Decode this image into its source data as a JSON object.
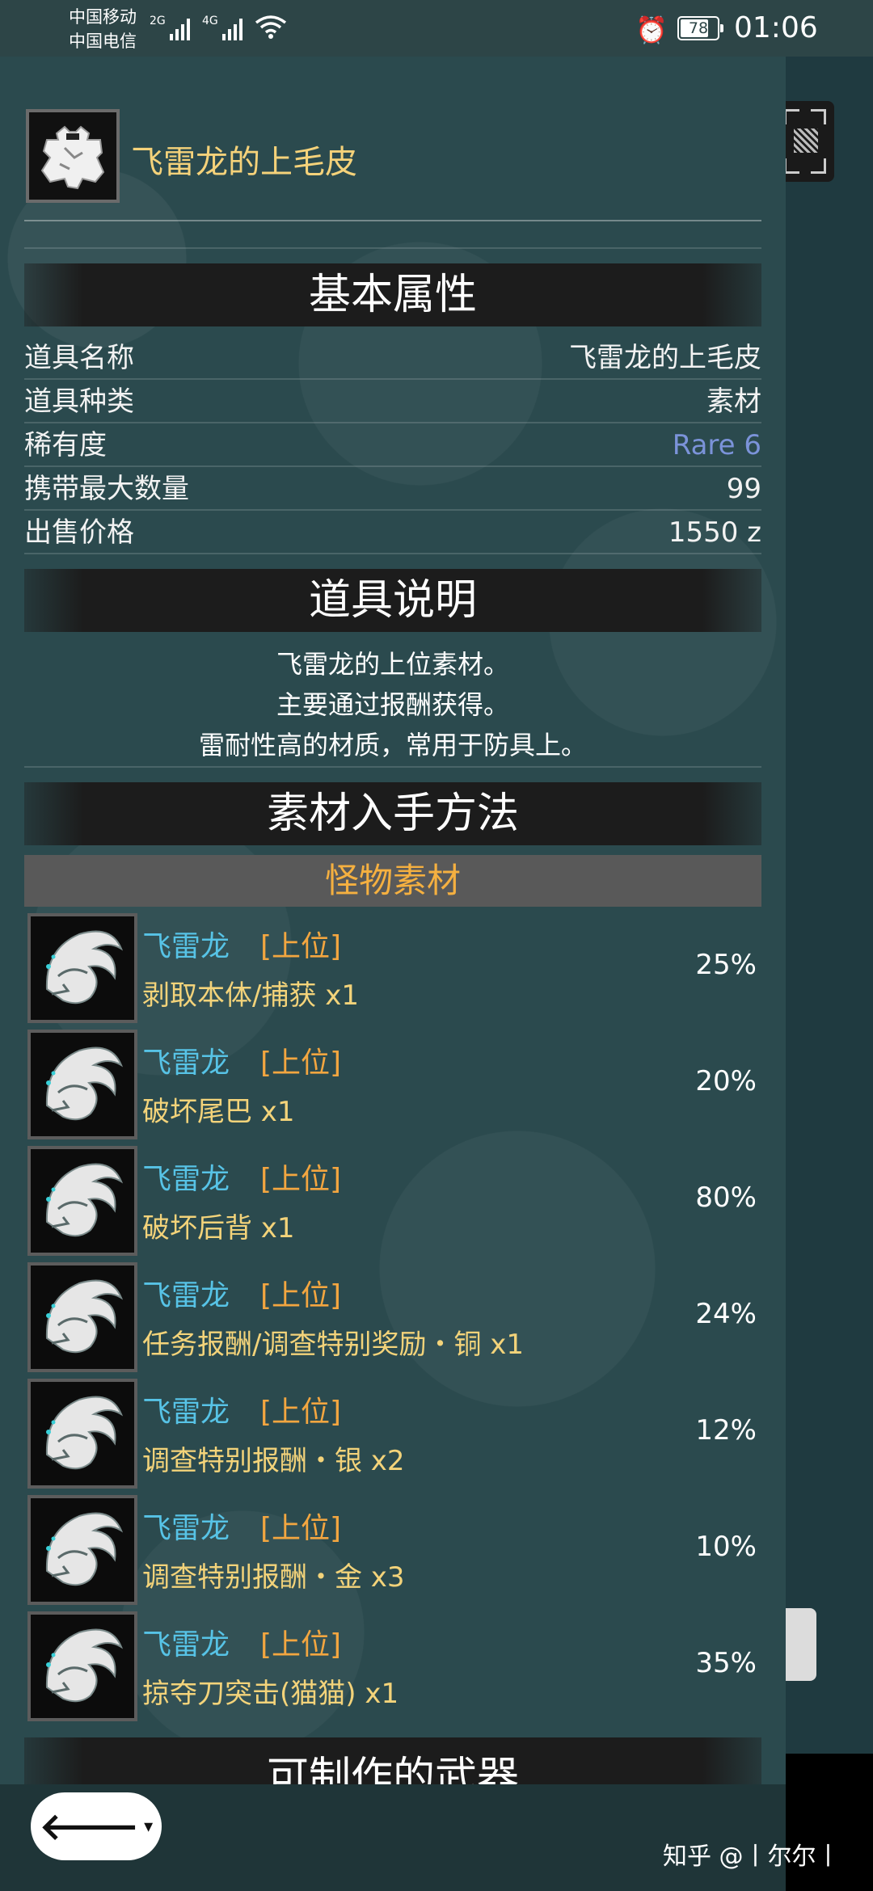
{
  "status_bar": {
    "carrier1": "中国移动",
    "carrier2": "中国电信",
    "net1": "2G",
    "net2": "4G",
    "battery": "78",
    "time": "01:06"
  },
  "item": {
    "title": "飞雷龙的上毛皮",
    "icon": "pelt-icon"
  },
  "basic": {
    "heading": "基本属性",
    "rows": [
      {
        "key": "道具名称",
        "value": "飞雷龙的上毛皮"
      },
      {
        "key": "道具种类",
        "value": "素材"
      },
      {
        "key": "稀有度",
        "value": "Rare 6"
      },
      {
        "key": "携带最大数量",
        "value": "99"
      },
      {
        "key": "出售价格",
        "value": "1550 z"
      }
    ]
  },
  "description": {
    "heading": "道具说明",
    "lines": [
      "飞雷龙的上位素材。",
      "主要通过报酬获得。",
      "雷耐性高的材质，常用于防具上。"
    ]
  },
  "sources": {
    "heading": "素材入手方法",
    "subheading": "怪物素材",
    "rows": [
      {
        "monster": "飞雷龙",
        "rank": "[上位]",
        "method": "剥取本体/捕获 x1",
        "pct": "25%"
      },
      {
        "monster": "飞雷龙",
        "rank": "[上位]",
        "method": "破坏尾巴 x1",
        "pct": "20%"
      },
      {
        "monster": "飞雷龙",
        "rank": "[上位]",
        "method": "破坏后背 x1",
        "pct": "80%"
      },
      {
        "monster": "飞雷龙",
        "rank": "[上位]",
        "method": "任务报酬/调查特别奖励・铜 x1",
        "pct": "24%"
      },
      {
        "monster": "飞雷龙",
        "rank": "[上位]",
        "method": "调查特别报酬・银 x2",
        "pct": "12%"
      },
      {
        "monster": "飞雷龙",
        "rank": "[上位]",
        "method": "调查特别报酬・金 x3",
        "pct": "10%"
      },
      {
        "monster": "飞雷龙",
        "rank": "[上位]",
        "method": "掠夺刀突击(猫猫) x1",
        "pct": "35%"
      }
    ]
  },
  "weapons": {
    "heading": "可制作的武器"
  },
  "bottom": {
    "back_label": "🡐",
    "caret": "▾",
    "watermark": "知乎 @丨尔尔丨"
  }
}
